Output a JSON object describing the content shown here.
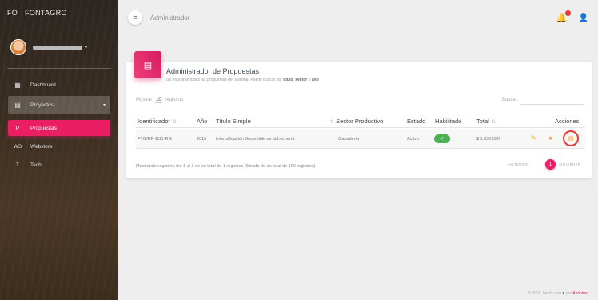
{
  "sidebar": {
    "brand_mini": "FO",
    "brand_name": "FONTAGRO",
    "user_caret": "▾",
    "items": [
      {
        "icon": "▦",
        "label": "Dashboard"
      },
      {
        "icon": "▤",
        "label": "Proyectos",
        "chevron": "▾"
      },
      {
        "mini": "P",
        "label": "Propuestas"
      },
      {
        "mini": "WS",
        "label": "Webstore"
      },
      {
        "mini": "T",
        "label": "Tech"
      }
    ]
  },
  "topbar": {
    "menu_icon": "≡",
    "title": "Administrador",
    "bell_icon": "🔔",
    "person_icon": "👤"
  },
  "card": {
    "title": "Administrador de Propuestas",
    "subtitle_prefix": "Se muestran todos los propuestas del sistema. Puede buscar por",
    "subtitle_bold_1": "título",
    "subtitle_sep": ",",
    "subtitle_bold_2": "sector",
    "subtitle_or": "o",
    "subtitle_bold_3": "año",
    "show_label": "Mostrar",
    "show_value": "10",
    "show_suffix": "registros",
    "search_label": "Buscar:",
    "columns": [
      "Identificador",
      "Año",
      "Título Simple",
      "Sector Productivo",
      "Estado",
      "Habilitado",
      "Total",
      "Acciones"
    ],
    "row": {
      "id": "FTG/RF-1111-RG",
      "year": "2016",
      "title": "Intensificación Sostenible de la Lechería",
      "sector": "Ganadería",
      "status": "Activo",
      "enabled": "✔",
      "total": "$ 1.650.500"
    },
    "actions": {
      "edit": "✎",
      "location": "●",
      "doc": "▤"
    },
    "footer_info": "Mostrando registros del 1 al 1 de un total de 1 registros (filtrado de un total de 160 registros)",
    "pager": {
      "prev": "ANTERIOR",
      "page": "1",
      "next": "SIGUIENTE"
    }
  },
  "footer": {
    "copyright": "© 2019, hecho con",
    "heart": "♥",
    "by": "por",
    "link": "Anónimo"
  }
}
